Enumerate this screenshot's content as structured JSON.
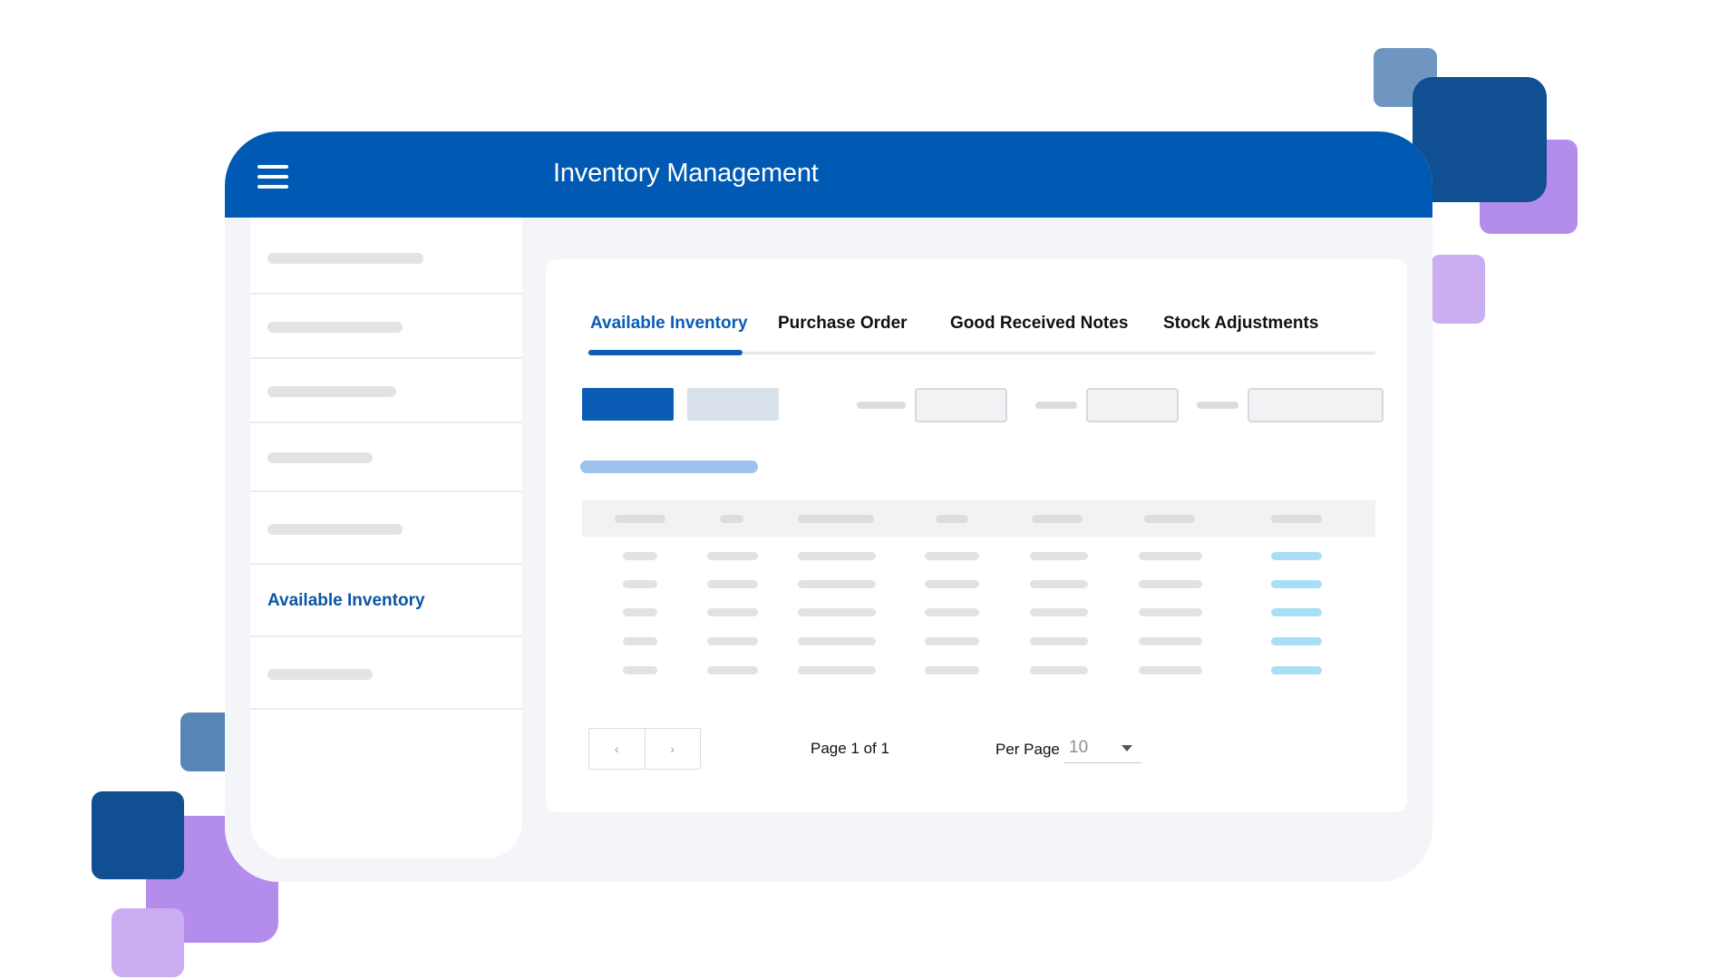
{
  "colors": {
    "header": "#0059b3",
    "accent": "#0b5cb5",
    "deco_dark": "#0f4f92",
    "deco_mid": "#6f96c0",
    "deco_purple": "#b48ceb",
    "deco_light_purple": "#cbadf2"
  },
  "header": {
    "menu_icon": "hamburger-icon",
    "title": "Inventory Management"
  },
  "sidebar": {
    "active_label": "Available Inventory"
  },
  "tabs": [
    {
      "label": "Available Inventory",
      "active": true
    },
    {
      "label": "Purchase Order",
      "active": false
    },
    {
      "label": "Good Received Notes",
      "active": false
    },
    {
      "label": "Stock Adjustments",
      "active": false
    }
  ],
  "pagination": {
    "prev_symbol": "‹",
    "next_symbol": "›",
    "page_info": "Page 1 of 1",
    "per_page_label": "Per Page",
    "per_page_value": "10"
  }
}
